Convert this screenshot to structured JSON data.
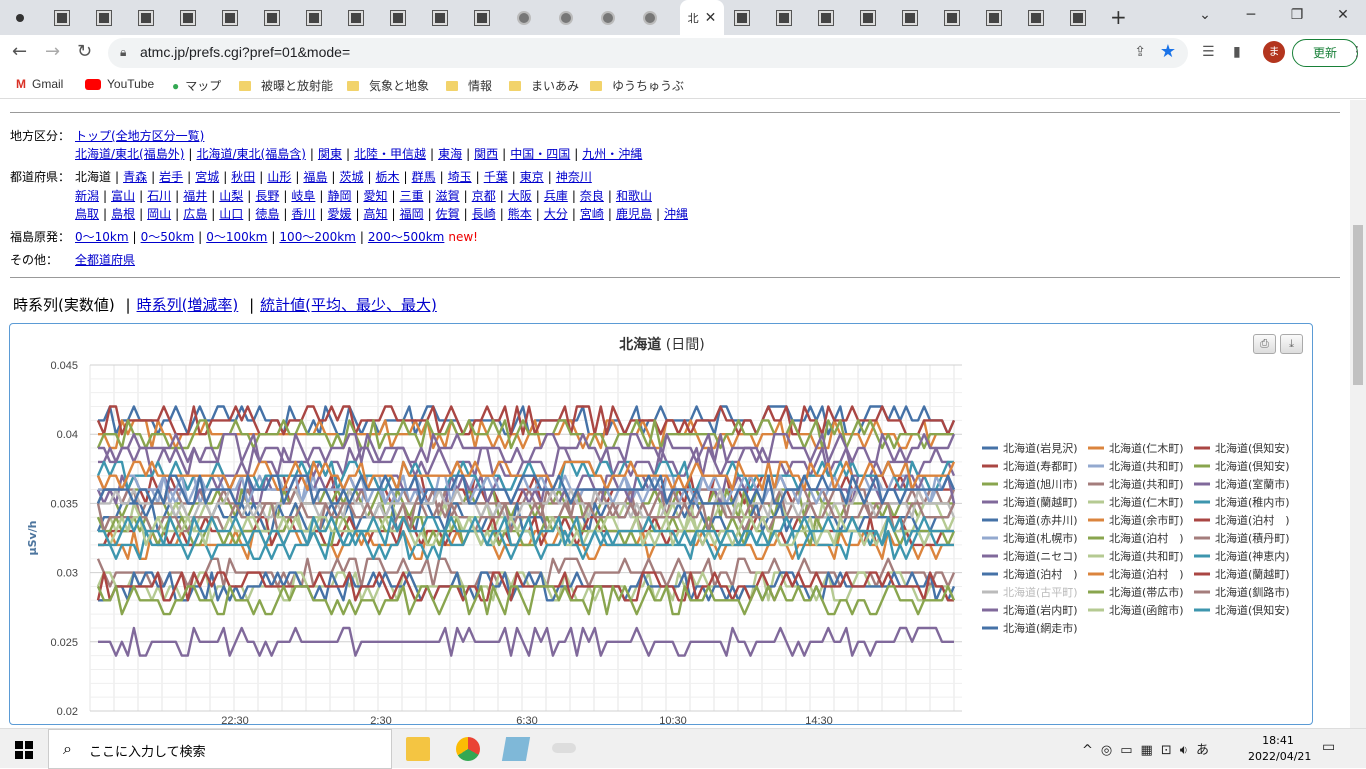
{
  "browser": {
    "url": "atmc.jp/prefs.cgi?pref=01&mode=",
    "active_tab_label": "北",
    "update_label": "更新",
    "avatar_initial": "ま",
    "bookmarks": [
      "Gmail",
      "YouTube",
      "マップ",
      "被曝と放射能",
      "気象と地象",
      "情報",
      "まいあみ",
      "ゆうちゅうぶ"
    ]
  },
  "nav": {
    "region_label": "地方区分：",
    "region_top": "トップ(全地方区分一覧)",
    "regions": [
      "北海道/東北(福島外)",
      "北海道/東北(福島含)",
      "関東",
      "北陸・甲信越",
      "東海",
      "関西",
      "中国・四国",
      "九州・沖縄"
    ],
    "pref_label": "都道府県：",
    "pref_current": "北海道",
    "prefs_row1": [
      "青森",
      "岩手",
      "宮城",
      "秋田",
      "山形",
      "福島",
      "茨城",
      "栃木",
      "群馬",
      "埼玉",
      "千葉",
      "東京",
      "神奈川"
    ],
    "prefs_row2": [
      "新潟",
      "富山",
      "石川",
      "福井",
      "山梨",
      "長野",
      "岐阜",
      "静岡",
      "愛知",
      "三重",
      "滋賀",
      "京都",
      "大阪",
      "兵庫",
      "奈良",
      "和歌山"
    ],
    "prefs_row3": [
      "鳥取",
      "島根",
      "岡山",
      "広島",
      "山口",
      "徳島",
      "香川",
      "愛媛",
      "高知",
      "福岡",
      "佐賀",
      "長崎",
      "熊本",
      "大分",
      "宮崎",
      "鹿児島",
      "沖縄"
    ],
    "fukushima_label": "福島原発：",
    "fukushima_ranges": [
      "0〜10km",
      "0〜50km",
      "0〜100km",
      "100〜200km",
      "200〜500km"
    ],
    "new_label": "new!",
    "other_label": "その他：",
    "other_link": "全都道府県"
  },
  "view_tabs": {
    "current": "時系列(実数値)",
    "links": [
      "時系列(増減率)",
      "統計値(平均、最少、最大)"
    ]
  },
  "chart_data": {
    "type": "line",
    "title": "北海道",
    "subtitle": "(日間)",
    "ylabel": "μSv/h",
    "ylim": [
      0.02,
      0.045
    ],
    "yticks": [
      "0.045",
      "0.04",
      "0.035",
      "0.03",
      "0.025",
      "0.02"
    ],
    "xticks": [
      "22:30",
      "2:30",
      "6:30",
      "10:30",
      "14:30"
    ],
    "grid": true,
    "legend_position": "right",
    "series": [
      {
        "name": "北海道(岩見沢)",
        "color": "#4572a7",
        "base": 0.041
      },
      {
        "name": "北海道(仁木町)",
        "color": "#db843d",
        "base": 0.04
      },
      {
        "name": "北海道(倶知安)",
        "color": "#aa4643",
        "base": 0.041
      },
      {
        "name": "北海道(寿都町)",
        "color": "#aa4643",
        "base": 0.036
      },
      {
        "name": "北海道(共和町)",
        "color": "#93a9cf",
        "base": 0.036
      },
      {
        "name": "北海道(倶知安)",
        "color": "#89a54e",
        "base": 0.04
      },
      {
        "name": "北海道(旭川市)",
        "color": "#89a54e",
        "base": 0.035
      },
      {
        "name": "北海道(共和町)",
        "color": "#a47d7c",
        "base": 0.035
      },
      {
        "name": "北海道(室蘭市)",
        "color": "#80699b",
        "base": 0.038
      },
      {
        "name": "北海道(蘭越町)",
        "color": "#80699b",
        "base": 0.036
      },
      {
        "name": "北海道(仁木町)",
        "color": "#b5ca92",
        "base": 0.034
      },
      {
        "name": "北海道(稚内市)",
        "color": "#3d96ae",
        "base": 0.037
      },
      {
        "name": "北海道(赤井川)",
        "color": "#4572a7",
        "base": 0.034
      },
      {
        "name": "北海道(余市町)",
        "color": "#db843d",
        "base": 0.032
      },
      {
        "name": "北海道(泊村　)",
        "color": "#aa4643",
        "base": 0.033
      },
      {
        "name": "北海道(札幌市)",
        "color": "#93a9cf",
        "base": 0.036
      },
      {
        "name": "北海道(泊村　)",
        "color": "#89a54e",
        "base": 0.033
      },
      {
        "name": "北海道(積丹町)",
        "color": "#a47d7c",
        "base": 0.03
      },
      {
        "name": "北海道(ニセコ)",
        "color": "#80699b",
        "base": 0.025
      },
      {
        "name": "北海道(共和町)",
        "color": "#b5ca92",
        "base": 0.029
      },
      {
        "name": "北海道(神恵内)",
        "color": "#3d96ae",
        "base": 0.032
      },
      {
        "name": "北海道(泊村　)",
        "color": "#4572a7",
        "base": 0.029
      },
      {
        "name": "北海道(泊村　)",
        "color": "#db843d",
        "base": 0.037
      },
      {
        "name": "北海道(蘭越町)",
        "color": "#aa4643",
        "base": 0.029
      },
      {
        "name": "北海道(古平町)",
        "color": "#bbbbbb",
        "base": 0.035
      },
      {
        "name": "北海道(帯広市)",
        "color": "#89a54e",
        "base": 0.028
      },
      {
        "name": "北海道(釧路市)",
        "color": "#a47d7c",
        "base": 0.034
      },
      {
        "name": "北海道(岩内町)",
        "color": "#80699b",
        "base": 0.039
      },
      {
        "name": "北海道(函館市)",
        "color": "#b5ca92",
        "base": 0.033
      },
      {
        "name": "北海道(倶知安)",
        "color": "#3d96ae",
        "base": 0.033
      },
      {
        "name": "北海道(網走市)",
        "color": "#4572a7",
        "base": 0.036
      }
    ]
  },
  "taskbar": {
    "search_placeholder": "ここに入力して検索",
    "time": "18:41",
    "date": "2022/04/21",
    "ime": "あ"
  }
}
